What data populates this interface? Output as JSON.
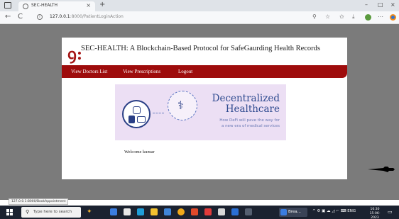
{
  "browser": {
    "tab_title": "SEC-HEALTH",
    "tab_close": "×",
    "new_tab": "+",
    "window_controls": {
      "minimize": "–",
      "maximize": "□",
      "close": "×"
    },
    "nav": {
      "back": "←",
      "refresh": "C"
    },
    "address": {
      "host": "127.0.0.1",
      "rest": ":8000/PatientLoginAction"
    }
  },
  "site": {
    "logo_glyph": "ꝯ:",
    "title": "SEC-HEALTH: A Blockchain-Based Protocol for SafeGaurding Health Records",
    "nav": [
      "View Doctors List",
      "View Prescriptions",
      "Logout"
    ],
    "accent_color": "#9e0c0c"
  },
  "banner": {
    "heading_line1": "Decentralized",
    "heading_line2": "Healthcare",
    "sub_line1": "How DeFi will pave the way for",
    "sub_line2": "a new era of medical services"
  },
  "main": {
    "welcome": "Welcome kumar"
  },
  "status_bar": {
    "url": "127.0.0.1:8000/BookAppointment"
  },
  "taskbar": {
    "search_placeholder": "Type here to search",
    "active_app_label": "Brea...",
    "tray_text": "^ ⚙ ▣ ☁ ◿ ⌐ ⌨ ENG",
    "time": "16:30",
    "date": "15-06-2023"
  }
}
